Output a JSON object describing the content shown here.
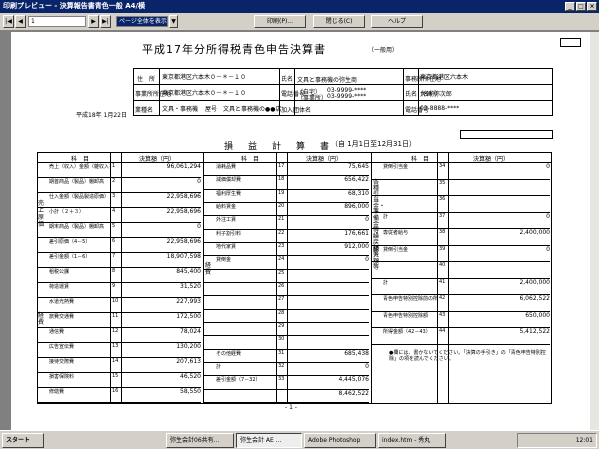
{
  "window": {
    "title": "印刷プレビュー - 決算報告書青色一般 A4/横"
  },
  "toolbar": {
    "page_value": "1",
    "zoom_label": "ページ全体を表示",
    "print_label": "印刷(P)...",
    "close_label": "閉じる(C)",
    "help_label": "ヘルプ"
  },
  "doc": {
    "title": "平成17年分所得税青色申告決算書",
    "title_sub": "（一般用）",
    "date": "平成18年 1月22日",
    "h_addr": "住　所",
    "h_place": "事業所所在地",
    "h_job": "業種名",
    "h_shop": "屋号",
    "addr": "東京都港区六本木０－＊－１０",
    "place": "東京都港区六本木０－＊－１０",
    "job": "文具・事務機",
    "shop": "文具と事務機の●●店",
    "h_name": "氏名",
    "name": "文具と事務機の弥生商",
    "h_phone": "電話番号",
    "phone1": "03-9999-****",
    "phone2": "03-9999-****",
    "phone_lbl1": "（自宅）",
    "phone_lbl2": "（事業所）",
    "h_join": "加入団体名",
    "h_tax": "税理士",
    "tax_place": "事務所所在地",
    "tax_addr": "東京都港区六本木",
    "tax_name_h": "氏名（名称）",
    "tax_name": "大崎 弥次郎",
    "tax_phone_h": "電話番号",
    "tax_phone": "03-8888-****",
    "pl_title": "損　益　計　算　書",
    "pl_period": "（自 1月1日至12月31日）",
    "hdr_item": "科　目",
    "hdr_amount": "決算額（円）",
    "col1": [
      {
        "n": "1",
        "l": "売上（収入）金額（雑収入を含む）",
        "v": "96,061,294"
      },
      {
        "n": "2",
        "l": "期首商品（製品）棚卸高",
        "v": "0"
      },
      {
        "n": "3",
        "l": "仕入金額（製品製造原価）",
        "v": "22,958,696"
      },
      {
        "n": "4",
        "l": "小計（２＋３）",
        "v": "22,958,696"
      },
      {
        "n": "5",
        "l": "期末商品（製品）棚卸高",
        "v": "0"
      },
      {
        "n": "6",
        "l": "差引原価（4－5）",
        "v": "22,958,696"
      },
      {
        "n": "7",
        "l": "差引金額（1－6）",
        "v": "18,907,598"
      },
      {
        "n": "8",
        "l": "租税公課",
        "v": "845,400"
      },
      {
        "n": "9",
        "l": "荷造運賃",
        "v": "31,520"
      },
      {
        "n": "10",
        "l": "水道光熱費",
        "v": "227,993"
      },
      {
        "n": "11",
        "l": "旅費交通費",
        "v": "172,500"
      },
      {
        "n": "12",
        "l": "通信費",
        "v": "78,024"
      },
      {
        "n": "13",
        "l": "広告宣伝費",
        "v": "130,200"
      },
      {
        "n": "14",
        "l": "接待交際費",
        "v": "207,613"
      },
      {
        "n": "15",
        "l": "損害保険料",
        "v": "46,520"
      },
      {
        "n": "16",
        "l": "修繕費",
        "v": "58,550"
      }
    ],
    "col1_groups": [
      "売上原価",
      "経費"
    ],
    "col2": [
      {
        "n": "17",
        "l": "消耗品費",
        "v": "75,645"
      },
      {
        "n": "18",
        "l": "減価償却費",
        "v": "656,422"
      },
      {
        "n": "19",
        "l": "福利厚生費",
        "v": "68,310"
      },
      {
        "n": "20",
        "l": "給料賃金",
        "v": "896,000"
      },
      {
        "n": "21",
        "l": "外注工賃",
        "v": "0"
      },
      {
        "n": "22",
        "l": "利子割引料",
        "v": "176,661"
      },
      {
        "n": "23",
        "l": "地代家賃",
        "v": "912,000"
      },
      {
        "n": "24",
        "l": "貸倒金",
        "v": "0"
      },
      {
        "n": "25",
        "l": "",
        "v": ""
      },
      {
        "n": "26",
        "l": "",
        "v": ""
      },
      {
        "n": "27",
        "l": "",
        "v": ""
      },
      {
        "n": "28",
        "l": "",
        "v": ""
      },
      {
        "n": "29",
        "l": "",
        "v": ""
      },
      {
        "n": "30",
        "l": "",
        "v": ""
      },
      {
        "n": "31",
        "l": "その他経費",
        "v": "685,438"
      },
      {
        "n": "32",
        "l": "計",
        "v": "0"
      },
      {
        "n": "33",
        "l": "差引金額（7－32）",
        "v": "4,445,076"
      },
      {
        "n": "",
        "l": "",
        "v": "8,462,522"
      }
    ],
    "col2_group": "経費",
    "col3": [
      {
        "n": "34",
        "l": "貸倒引当金",
        "v": "0"
      },
      {
        "n": "35",
        "l": "",
        "v": ""
      },
      {
        "n": "36",
        "l": "",
        "v": ""
      },
      {
        "n": "37",
        "l": "計",
        "v": "0"
      },
      {
        "n": "38",
        "l": "専従者給与",
        "v": "2,400,000"
      },
      {
        "n": "39",
        "l": "貸倒引当金",
        "v": "0"
      },
      {
        "n": "40",
        "l": "",
        "v": ""
      },
      {
        "n": "41",
        "l": "計",
        "v": "2,400,000"
      },
      {
        "n": "42",
        "l": "青色申告特別控除前の所得金額（33＋37－41）",
        "v": "6,062,522"
      },
      {
        "n": "43",
        "l": "青色申告特別控除額",
        "v": "650,000"
      },
      {
        "n": "44",
        "l": "所得金額（42－43）",
        "v": "5,412,522"
      }
    ],
    "col3_group1": "各種引当金・準備金等 繰戻額等",
    "col3_group2": "繰入額等",
    "note": "●欄には、書かないでください。「決算の手引き」の「青色申告特別控除」の項を読んでください。",
    "page": "- 1 -"
  },
  "taskbar": {
    "start": "スタート",
    "task1": "弥生会計06共有...",
    "task2": "弥生会計 AE ...",
    "task3": "Adobe Photoshop",
    "task4": "index.htm - 秀丸",
    "clock": "12:01"
  }
}
